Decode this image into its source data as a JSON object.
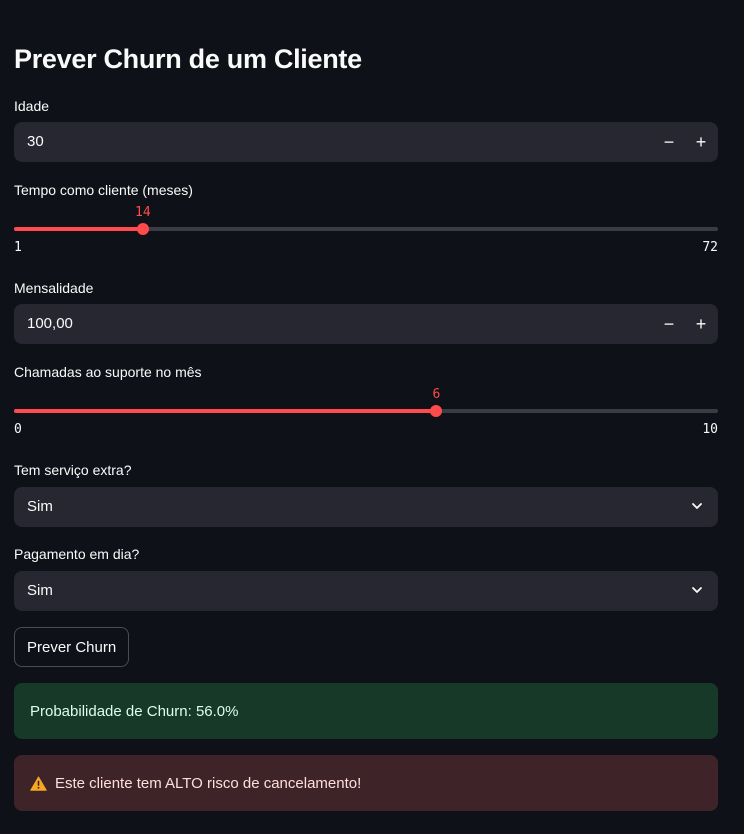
{
  "page": {
    "title": "Prever Churn de um Cliente"
  },
  "fields": {
    "idade": {
      "label": "Idade",
      "value": "30",
      "minus": "−",
      "plus": "+"
    },
    "tempo": {
      "label": "Tempo como cliente (meses)",
      "value": "14",
      "min": "1",
      "max": "72",
      "fraction": 0.183
    },
    "mensalidade": {
      "label": "Mensalidade",
      "value": "100,00",
      "minus": "−",
      "plus": "+"
    },
    "chamadas": {
      "label": "Chamadas ao suporte no mês",
      "value": "6",
      "min": "0",
      "max": "10",
      "fraction": 0.6
    },
    "servico_extra": {
      "label": "Tem serviço extra?",
      "selected": "Sim"
    },
    "pagamento": {
      "label": "Pagamento em dia?",
      "selected": "Sim"
    }
  },
  "actions": {
    "predict_label": "Prever Churn"
  },
  "results": {
    "probability_text": "Probabilidade de Churn: 56.0%",
    "warning_text": "Este cliente tem ALTO risco de cancelamento!",
    "warning_icon": "warning-icon"
  },
  "colors": {
    "background": "#0e1117",
    "input_bg": "#262730",
    "accent": "#ff4b4b",
    "success_bg": "#173928",
    "error_bg": "#3e2428"
  }
}
